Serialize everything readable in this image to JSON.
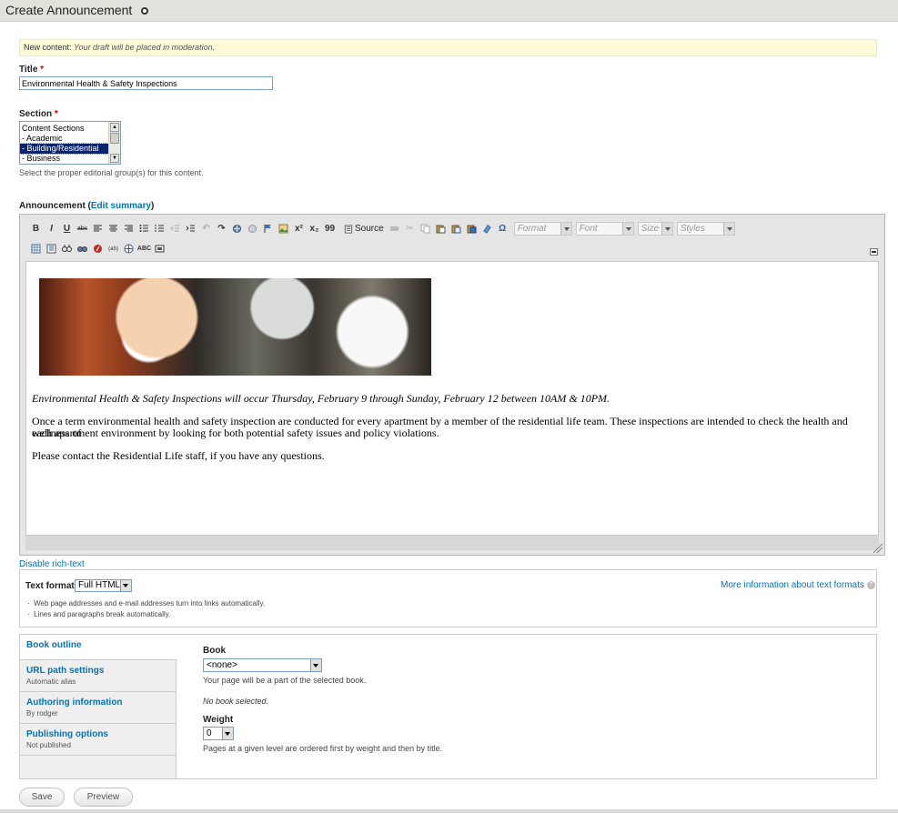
{
  "header": {
    "title": "Create Announcement"
  },
  "notice": {
    "prefix": "New content:",
    "message": "Your draft will be placed in moderation."
  },
  "title_field": {
    "label": "Title",
    "required_mark": "*",
    "value": "Environmental Health & Safety Inspections"
  },
  "section_field": {
    "label": "Section",
    "required_mark": "*",
    "options": [
      "Content Sections",
      "- Academic",
      "- Building/Residential",
      "- Business"
    ],
    "selected_index": 2,
    "help": "Select the proper editorial group(s) for this content."
  },
  "body_field": {
    "label": "Announcement",
    "edit_summary": "Edit summary",
    "toolbar": {
      "row1": [
        "bold-icon",
        "italic-icon",
        "underline-icon",
        "strike-icon",
        "align-left-icon",
        "align-center-icon",
        "align-right-icon",
        "bulleted-list-icon",
        "numbered-list-icon",
        "outdent-icon",
        "indent-icon",
        "undo-icon",
        "redo-icon",
        "link-icon",
        "unlink-icon",
        "anchor-icon",
        "image-icon",
        "superscript-icon",
        "subscript-icon",
        "blockquote-icon"
      ],
      "source_label": "Source",
      "row1_after": [
        "horizontal-rule-icon",
        "cut-icon",
        "copy-icon",
        "paste-icon",
        "paste-text-icon",
        "paste-word-icon",
        "remove-format-icon",
        "special-char-icon"
      ],
      "combos": {
        "format": "Format",
        "font": "Font",
        "size": "Size",
        "styles": "Styles"
      },
      "row2": [
        "table-icon",
        "find-icon",
        "replace-icon",
        "select-all-icon",
        "flash-icon",
        "spell-abc-icon",
        "iframe-icon",
        "spellcheck-icon",
        "maximize-icon"
      ]
    },
    "content": {
      "image_alt": "student-with-shaving-cream",
      "line1": "Environmental Health & Safety Inspections will occur Thursday, February 9 through Sunday, February 12 between 10AM & 10PM.",
      "line2a": "Once a term environmental health and safety inspection are conducted for every apartment by a member of the residential life team.  These inspections are intended to check the health and wellness of",
      "line2b": "each apartment environment by looking for both potential safety issues and policy violations.",
      "line3": "Please contact the Residential Life staff, if you have any questions."
    },
    "disable_rich_text": "Disable rich-text"
  },
  "text_format": {
    "label": "Text format",
    "value": "Full HTML",
    "more_info": "More information about text formats",
    "tips": [
      "Web page addresses and e-mail addresses turn into links automatically.",
      "Lines and paragraphs break automatically."
    ]
  },
  "vertical_tabs": {
    "tabs": [
      {
        "title": "Book outline",
        "summary": ""
      },
      {
        "title": "URL path settings",
        "summary": "Automatic alias"
      },
      {
        "title": "Authoring information",
        "summary": "By rodger"
      },
      {
        "title": "Publishing options",
        "summary": "Not published"
      }
    ],
    "book": {
      "label": "Book",
      "value": "<none>",
      "help": "Your page will be a part of the selected book.",
      "status": "No book selected.",
      "weight_label": "Weight",
      "weight_value": "0",
      "weight_help": "Pages at a given level are ordered first by weight and then by title."
    }
  },
  "actions": {
    "save": "Save",
    "preview": "Preview"
  }
}
